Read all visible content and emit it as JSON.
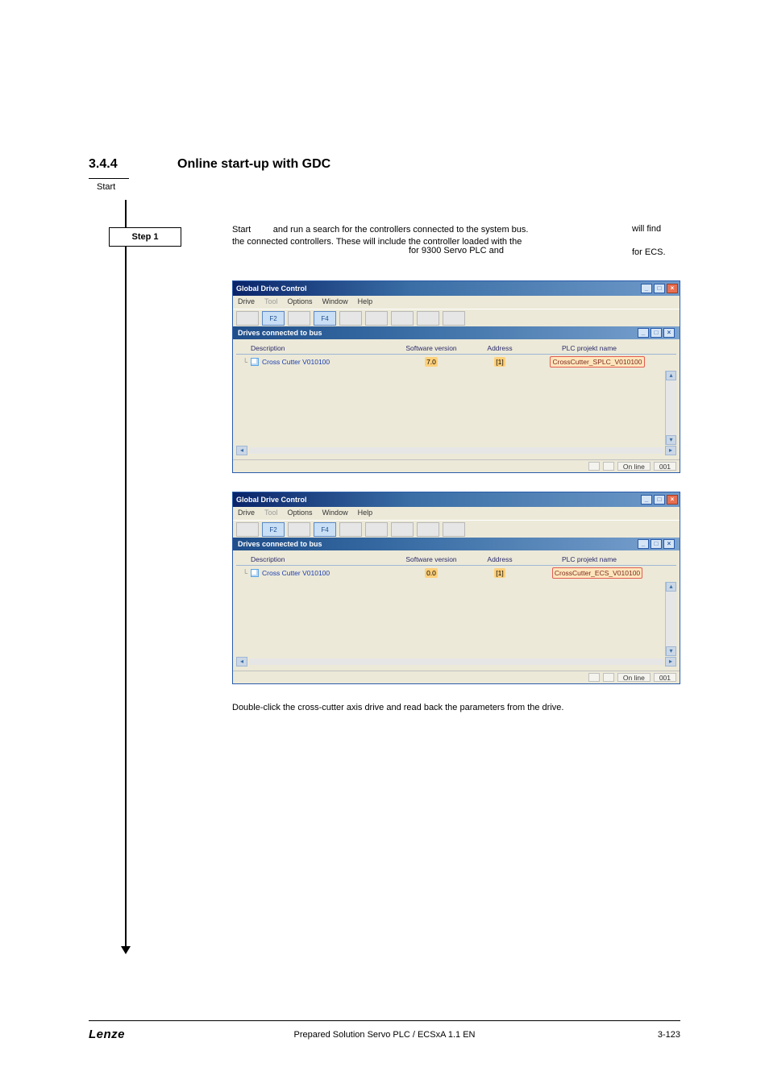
{
  "section": {
    "number": "3.4.4",
    "title": "Online start-up with GDC"
  },
  "flow": {
    "start": "Start",
    "step1": "Step 1"
  },
  "intro": {
    "line1_left": "Start",
    "line1_mid": "and run a search for the controllers connected to the system bus.",
    "line1_right": "will find",
    "line2": "the connected controllers. These will include the controller loaded with the",
    "line3_center": "for 9300 Servo PLC and",
    "line3_right": "for ECS."
  },
  "gdc_common": {
    "title": "Global Drive Control",
    "menu": {
      "drive": "Drive",
      "tool": "Tool",
      "options": "Options",
      "window": "Window",
      "help": "Help"
    },
    "toolbar_labels": {
      "f2": "F2",
      "f4": "F4"
    },
    "subwindow_title": "Drives connected to bus",
    "headers": {
      "desc": "Description",
      "sw": "Software version",
      "addr": "Address",
      "proj": "PLC projekt name"
    },
    "status": {
      "mode": "On line",
      "code": "001"
    },
    "wnd_btns": {
      "min": "_",
      "max": "□",
      "close": "×"
    },
    "scroll": {
      "up": "▴",
      "down": "▾",
      "left": "◂",
      "right": "▸"
    }
  },
  "gdc1": {
    "row": {
      "desc": "Cross Cutter V010100",
      "sw": "7.0",
      "addr": "[1]",
      "proj": "CrossCutter_SPLC_V010100"
    }
  },
  "gdc2": {
    "row": {
      "desc": "Cross Cutter V010100",
      "sw": "0.0",
      "addr": "[1]",
      "proj": "CrossCutter_ECS_V010100"
    }
  },
  "dblclick": "Double-click the cross-cutter axis drive and read back the parameters from the drive.",
  "footer": {
    "brand": "Lenze",
    "center": "Prepared Solution Servo PLC / ECSxA 1.1 EN",
    "page": "3-123"
  }
}
